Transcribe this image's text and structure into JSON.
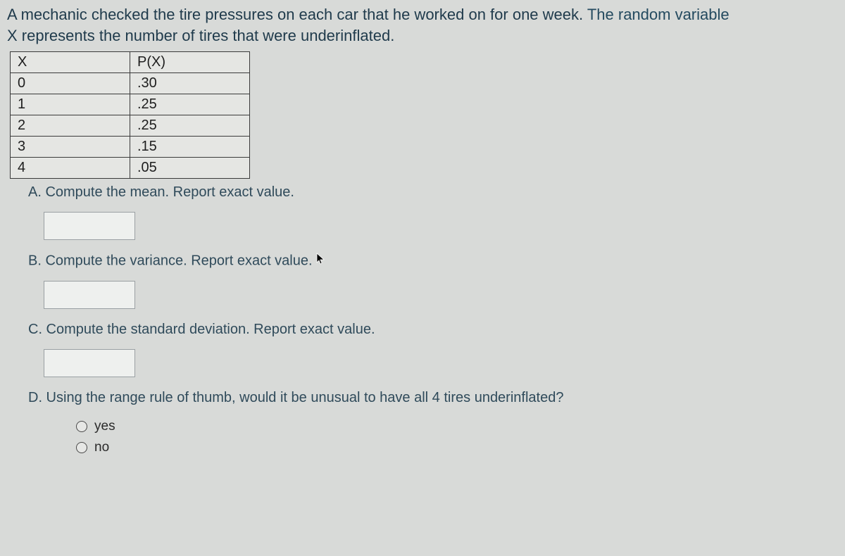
{
  "problem": {
    "line1_part1": "A mechanic checked the tire pressures on each car that he worked on for one week.  ",
    "line1_part2": "The random variable",
    "line2": "X represents the number of tires that were underinflated."
  },
  "table": {
    "headers": {
      "x": "X",
      "px": "P(X)"
    },
    "rows": [
      {
        "x": "0",
        "px": ".30"
      },
      {
        "x": "1",
        "px": ".25"
      },
      {
        "x": "2",
        "px": ".25"
      },
      {
        "x": "3",
        "px": ".15"
      },
      {
        "x": "4",
        "px": ".05"
      }
    ]
  },
  "questions": {
    "a": {
      "label": "A.  Compute the mean.   Report exact value."
    },
    "b": {
      "label": "B.  Compute the variance.   Report exact value."
    },
    "c": {
      "label": "C.  Compute the standard deviation.   Report exact value."
    },
    "d": {
      "label": "D.  Using the range rule of thumb, would it be unusual to have all 4 tires underinflated?",
      "options": {
        "yes": "yes",
        "no": "no"
      }
    }
  }
}
